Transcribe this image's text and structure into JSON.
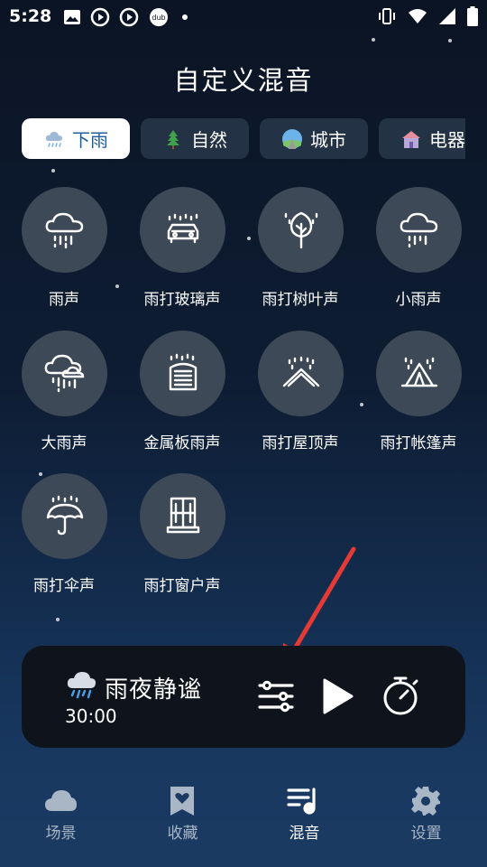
{
  "status_bar": {
    "time": "5:28"
  },
  "title": "自定义混音",
  "tabs": [
    {
      "label": "下雨",
      "icon": "rain-cloud-icon",
      "active": true
    },
    {
      "label": "自然",
      "icon": "tree-icon",
      "active": false
    },
    {
      "label": "城市",
      "icon": "city-road-icon",
      "active": false
    },
    {
      "label": "电器",
      "icon": "house-icon",
      "active": false
    }
  ],
  "sounds": [
    {
      "label": "雨声",
      "icon": "rain-cloud-icon"
    },
    {
      "label": "雨打玻璃声",
      "icon": "car-rain-icon"
    },
    {
      "label": "雨打树叶声",
      "icon": "tree-rain-icon"
    },
    {
      "label": "小雨声",
      "icon": "light-rain-icon"
    },
    {
      "label": "大雨声",
      "icon": "heavy-rain-icon"
    },
    {
      "label": "金属板雨声",
      "icon": "metal-shed-icon"
    },
    {
      "label": "雨打屋顶声",
      "icon": "roof-rain-icon"
    },
    {
      "label": "雨打帐篷声",
      "icon": "tent-rain-icon"
    },
    {
      "label": "雨打伞声",
      "icon": "umbrella-rain-icon"
    },
    {
      "label": "雨打窗户声",
      "icon": "window-icon"
    }
  ],
  "player": {
    "title": "雨夜静谧",
    "time": "30:00",
    "icon": "rain-cloud-emoji-icon"
  },
  "nav": [
    {
      "label": "场景",
      "icon": "cloud-icon",
      "active": false
    },
    {
      "label": "收藏",
      "icon": "bookmark-heart-icon",
      "active": false
    },
    {
      "label": "混音",
      "icon": "music-list-icon",
      "active": true
    },
    {
      "label": "设置",
      "icon": "gear-icon",
      "active": false
    }
  ],
  "colors": {
    "accent_tab_text": "#1d5f9e",
    "circle_bg": "#3e4957",
    "player_bg": "#0f141c",
    "arrow": "#e53935"
  }
}
